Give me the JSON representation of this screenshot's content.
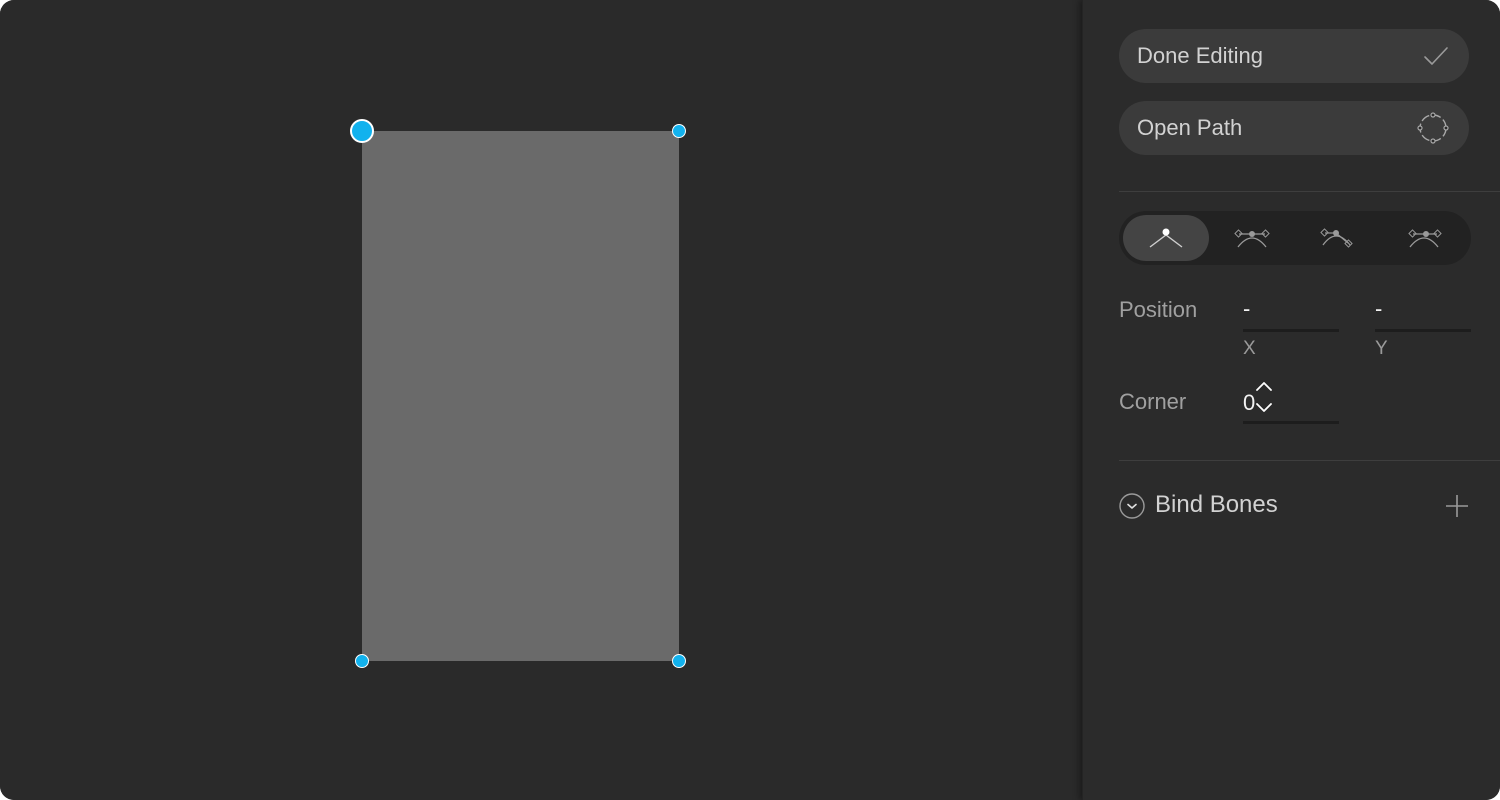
{
  "canvas": {
    "shape_fill": "#6a6a6a",
    "vertex_color": "#12b2ee"
  },
  "inspector": {
    "done_editing": {
      "label": "Done Editing",
      "icon": "checkmark-icon"
    },
    "open_path": {
      "label": "Open Path",
      "icon": "open-path-icon"
    },
    "vertex_modes": [
      {
        "icon": "straight-vertex-icon",
        "active": true
      },
      {
        "icon": "mirrored-vertex-icon",
        "active": false
      },
      {
        "icon": "detached-vertex-icon",
        "active": false
      },
      {
        "icon": "asymmetric-vertex-icon",
        "active": false
      }
    ],
    "position": {
      "label": "Position",
      "x_value": "-",
      "y_value": "-",
      "x_label": "X",
      "y_label": "Y"
    },
    "corner": {
      "label": "Corner",
      "value": "0"
    },
    "bind_bones": {
      "label": "Bind Bones",
      "toggle_icon": "chevron-down-icon",
      "add_icon": "plus-icon"
    }
  },
  "colors": {
    "background": "#2a2a2a",
    "panel": "#2b2b2b",
    "button": "#3b3b3b",
    "accent": "#12b2ee"
  }
}
